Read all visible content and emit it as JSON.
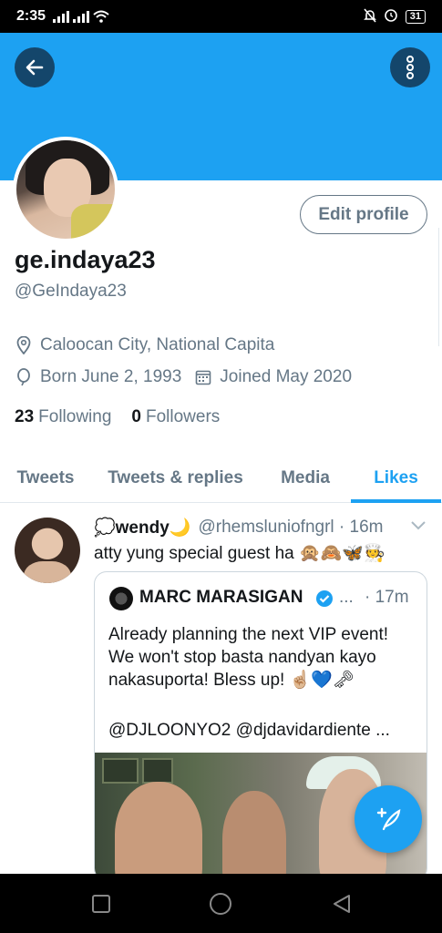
{
  "status_bar": {
    "time": "2:35",
    "battery": "31"
  },
  "colors": {
    "accent": "#1da1f2",
    "banner": "#1da1f2",
    "text_primary": "#14171a",
    "text_secondary": "#657786"
  },
  "header": {
    "back_icon": "arrow-left-icon",
    "more_icon": "more-vertical-icon"
  },
  "profile": {
    "edit_profile_label": "Edit profile",
    "display_name": "ge.indaya23",
    "handle": "@GeIndaya23",
    "location": "Caloocan City, National Capita",
    "birthday": "Born June 2, 1993",
    "joined": "Joined May 2020",
    "following_count": "23",
    "following_label": "Following",
    "followers_count": "0",
    "followers_label": "Followers"
  },
  "tabs": [
    {
      "label": "Tweets",
      "active": false
    },
    {
      "label": "Tweets & replies",
      "active": false
    },
    {
      "label": "Media",
      "active": false
    },
    {
      "label": "Likes",
      "active": true
    }
  ],
  "tweet": {
    "name": "💭wendy🌙",
    "handle_time": "@rhemslunio​fngrl · 16m",
    "text": "atty yung special guest ha 🙊🙈🦋🧑‍🍳",
    "quote": {
      "name": "MARC MARASIGAN",
      "dots": "...",
      "time": "· 17m",
      "text": "Already planning the next VIP event! We won't stop basta nandyan kayo nakasuporta! Bless up! ☝🏼💙🗝",
      "mentions": "@DJLOONYO2 @djdavidardiente ..."
    }
  },
  "fab": {
    "icon": "compose-tweet-icon"
  },
  "nav_bar": {
    "icons": [
      "recent-apps-icon",
      "home-icon",
      "back-icon"
    ]
  }
}
